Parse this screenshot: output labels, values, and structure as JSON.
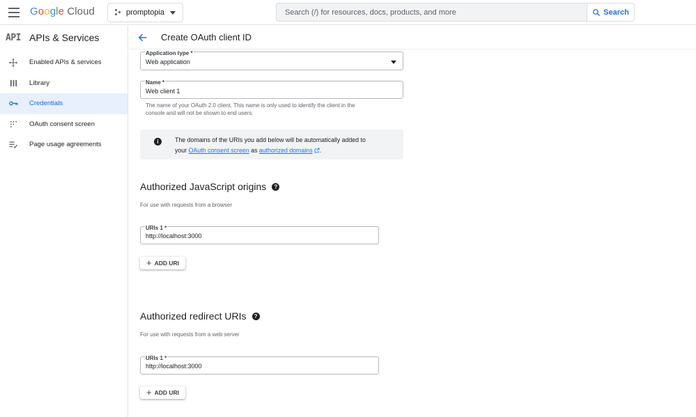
{
  "topbar": {
    "logo_google": "Google",
    "logo_cloud": "Cloud",
    "project_name": "promptopia",
    "search_placeholder": "Search (/) for resources, docs, products, and more",
    "search_button": "Search"
  },
  "sidebar": {
    "badge": "API",
    "title": "APIs & Services",
    "items": [
      {
        "label": "Enabled APIs & services",
        "icon": "hub-icon"
      },
      {
        "label": "Library",
        "icon": "library-grid-icon"
      },
      {
        "label": "Credentials",
        "icon": "key-icon",
        "active": true
      },
      {
        "label": "OAuth consent screen",
        "icon": "consent-dots-icon"
      },
      {
        "label": "Page usage agreements",
        "icon": "agreements-icon"
      }
    ]
  },
  "header": {
    "title": "Create OAuth client ID"
  },
  "form": {
    "app_type_label": "Application type *",
    "app_type_value": "Web application",
    "name_label": "Name *",
    "name_value": "Web client 1",
    "name_hint_1": "The name of your OAuth 2.0 client. This name is only used to identify the client in the",
    "name_hint_2": "console and will not be shown to end users.",
    "info_line1": "The domains of the URIs you add below will be automatically added to",
    "info_your": "your",
    "info_link1": "OAuth consent screen",
    "info_as": "as",
    "info_link2": "authorized domains",
    "info_end": "."
  },
  "js_origins": {
    "title": "Authorized JavaScript origins",
    "subtitle": "For use with requests from a browser",
    "uri_label": "URIs 1 *",
    "uri_value": "http://localhost:3000",
    "add_label": "ADD URI"
  },
  "redirects": {
    "title": "Authorized redirect URIs",
    "subtitle": "For use with requests from a web server",
    "uri_label": "URIs 1 *",
    "uri_value": "http://localhost:3000",
    "add_label": "ADD URI"
  },
  "colors": {
    "accent": "#1a73e8",
    "active_bg": "#e8f0fe"
  }
}
